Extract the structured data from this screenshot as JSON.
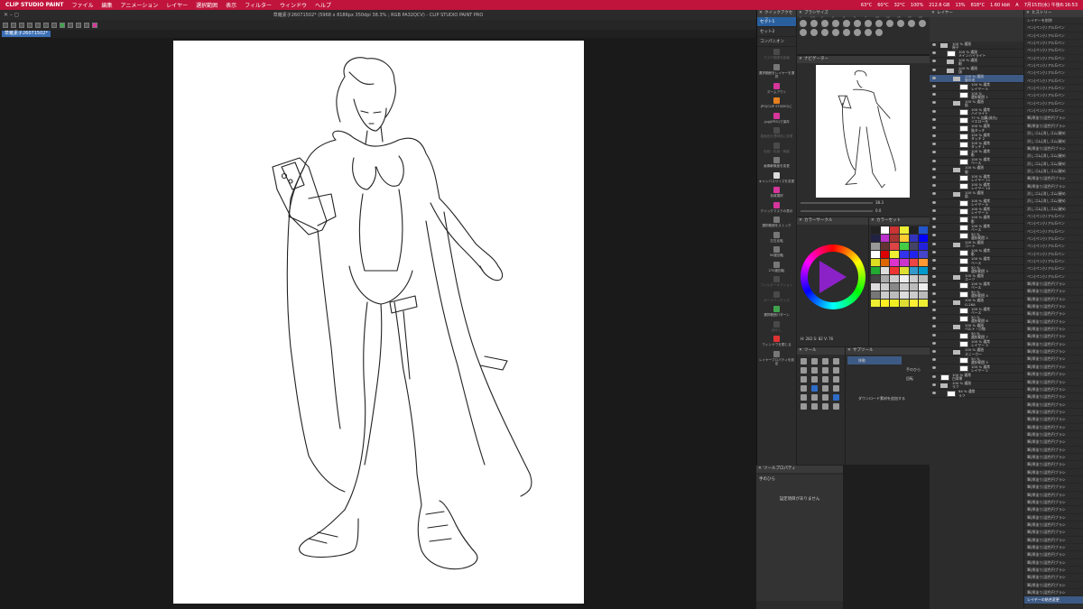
{
  "menubar": {
    "app": "CLIP STUDIO PAINT",
    "items": [
      "ファイル",
      "編集",
      "アニメーション",
      "レイヤー",
      "選択範囲",
      "表示",
      "フィルター",
      "ウィンドウ",
      "ヘルプ"
    ],
    "status": [
      "63°C",
      "60°C",
      "32°C",
      "100%",
      "212.6 GB",
      "13%",
      "818°C",
      "1.60 kbit",
      "A",
      "7月15日(水) 午後6:16:53"
    ]
  },
  "window": {
    "title": "草薙素子26071502* (5968 x 8186px 350dpi 38.3% ; RGB PA32QCV) - CLIP STUDIO PAINT PRO",
    "tab": "草薙素子26071502*"
  },
  "quickaccess": {
    "title": "クイックアクセス",
    "sets": [
      "セット1",
      "セット2",
      "コンパニオン"
    ],
    "items": [
      {
        "label": "マスク範囲を拡縮",
        "icon": "mask-icon",
        "dim": true
      },
      {
        "label": "選択範囲をレイヤーを選択",
        "icon": "selection-icon",
        "dim": false
      },
      {
        "label": "ズームアウト",
        "icon": "zoom-out-icon",
        "dim": false,
        "color": "mag"
      },
      {
        "label": "JPG(CLIP STUDIO)に",
        "icon": "export-icon",
        "dim": false,
        "color": "org"
      },
      {
        "label": ".jpg(JPEG)で保存",
        "icon": "save-jpg-icon",
        "dim": false,
        "color": "mag"
      },
      {
        "label": "描画色を透明色に変更",
        "icon": "transparent-icon",
        "dim": true
      },
      {
        "label": "色相・彩度・明度",
        "icon": "hue-icon",
        "dim": true
      },
      {
        "label": "画像解像度を変更",
        "icon": "resolution-icon",
        "dim": false
      },
      {
        "label": "キャンバスサイズを変更",
        "icon": "canvas-size-icon",
        "dim": false,
        "color": "wht"
      },
      {
        "label": "色域選択",
        "icon": "color-range-icon",
        "dim": false,
        "color": "mag"
      },
      {
        "label": "クイックマスクの表示",
        "icon": "quick-mask-icon",
        "dim": false,
        "color": "mag"
      },
      {
        "label": "選択範囲をストック",
        "icon": "stock-icon",
        "dim": false
      },
      {
        "label": "左右反転",
        "icon": "flip-icon",
        "dim": false
      },
      {
        "label": "90度回転",
        "icon": "rotate-icon",
        "dim": false
      },
      {
        "label": "270度回転",
        "icon": "rotate-270-icon",
        "dim": false
      },
      {
        "label": "フィルターオプション",
        "icon": "filter-icon",
        "dim": true,
        "color": "blu"
      },
      {
        "label": "ガードバッグイズ",
        "icon": "guard-icon",
        "dim": true
      },
      {
        "label": "選択範囲パターン",
        "icon": "pattern-icon",
        "dim": false,
        "color": "grn"
      },
      {
        "label": "ぼかし",
        "icon": "blur-icon",
        "dim": true
      },
      {
        "label": "ウィンドウを閉じる",
        "icon": "close-window-icon",
        "dim": false,
        "color": "red"
      },
      {
        "label": "レイヤープロパティを設定",
        "icon": "layer-prop-icon",
        "dim": false
      }
    ]
  },
  "brushsize": {
    "title": "ブラシサイズ",
    "sizes": [
      "1",
      "1.5",
      "2",
      "3",
      "4",
      "5",
      "7",
      "10",
      "12",
      "15",
      "17",
      "20",
      "25",
      "30",
      "40",
      "50",
      "60",
      "70",
      "80",
      "100"
    ]
  },
  "navigator": {
    "title": "ナビゲーター",
    "zoom": "38.3",
    "rotate": "0.0"
  },
  "colorcircle": {
    "title": "カラーサークル",
    "hsv": {
      "h": "H: 282",
      "s": "S: 82",
      "v": "V: 76"
    }
  },
  "colorset": {
    "title": "カラーセット",
    "swatches": [
      "#222",
      "#fff",
      "#c33",
      "#ee3",
      "#222",
      "#25c",
      "#224",
      "#b3c",
      "#a33",
      "#fc3",
      "#33b",
      "#00f",
      "#999",
      "#633",
      "#d44",
      "#4c4",
      "#446",
      "#22d",
      "#fff",
      "#d00",
      "#ee3",
      "#33e",
      "#22e",
      "#44c",
      "#dd2",
      "#d60",
      "#d3c",
      "#c3c",
      "#e44",
      "#f93",
      "#2a3",
      "#ddd",
      "#e33",
      "#dd3",
      "#39c",
      "#09c",
      "#444",
      "#aaa",
      "#ccc",
      "#eee",
      "#ccc",
      "#bbb",
      "#ddd",
      "#ccc",
      "#888",
      "#ccc",
      "#bbb",
      "#eee",
      "#777",
      "#ccc",
      "#bbb",
      "#ddd",
      "#ccc",
      "#bbb",
      "#ee3",
      "#fe2",
      "#ee2",
      "#dd3",
      "#fe3",
      "#ee3"
    ]
  },
  "tool": {
    "title": "ツール"
  },
  "subtool": {
    "title": "サブツール",
    "items": [
      "移動",
      "手のひら",
      "回転"
    ],
    "add": "ダウンロード素材を追加する"
  },
  "toolprop": {
    "title": "ツールプロパティ",
    "header": "手のひら",
    "empty": "設定項目がありません"
  },
  "layer": {
    "title": "レイヤー",
    "rows": [
      {
        "indent": 0,
        "kind": "folder",
        "l1": "100 % 通過",
        "l2": "原子"
      },
      {
        "indent": 1,
        "kind": "thumb",
        "l1": "100 % 通過",
        "l2": "メインハイライト"
      },
      {
        "indent": 1,
        "kind": "folder",
        "l1": "100 % 通過",
        "l2": "眼"
      },
      {
        "indent": 1,
        "kind": "folder",
        "l1": "100 % 通過",
        "l2": "顔"
      },
      {
        "indent": 2,
        "kind": "folder",
        "l1": "100 % 通過",
        "l2": "髪の毛",
        "sel": true
      },
      {
        "indent": 3,
        "kind": "thumb",
        "l1": "100 % 通常",
        "l2": "レイヤー 5"
      },
      {
        "indent": 3,
        "kind": "thumb",
        "l1": "100 %",
        "l2": "選択範囲 1"
      },
      {
        "indent": 2,
        "kind": "folder",
        "l1": "100 % 通過",
        "l2": "肌"
      },
      {
        "indent": 3,
        "kind": "thumb",
        "l1": "100 % 通常",
        "l2": "ハイライト"
      },
      {
        "indent": 3,
        "kind": "thumb",
        "l1": "77 % 加算(発光)",
        "l2": "イエロー光"
      },
      {
        "indent": 3,
        "kind": "thumb",
        "l1": "100 % 通常",
        "l2": "陰タッチ"
      },
      {
        "indent": 3,
        "kind": "thumb",
        "l1": "100 % 通常",
        "l2": "タッチ 2"
      },
      {
        "indent": 3,
        "kind": "thumb",
        "l1": "100 % 通常",
        "l2": "タッチ 1"
      },
      {
        "indent": 3,
        "kind": "thumb",
        "l1": "100 % 通常",
        "l2": "影"
      },
      {
        "indent": 3,
        "kind": "thumb",
        "l1": "100 % 通常",
        "l2": "ベース"
      },
      {
        "indent": 2,
        "kind": "folder",
        "l1": "100 % 通過",
        "l2": "服"
      },
      {
        "indent": 3,
        "kind": "thumb",
        "l1": "100 % 通常",
        "l2": "レイヤー 11"
      },
      {
        "indent": 3,
        "kind": "thumb",
        "l1": "100 % 通常",
        "l2": "レイヤー 10"
      },
      {
        "indent": 2,
        "kind": "folder",
        "l1": "100 % 通過",
        "l2": "肌"
      },
      {
        "indent": 3,
        "kind": "thumb",
        "l1": "100 % 通常",
        "l2": "レイヤー 8"
      },
      {
        "indent": 3,
        "kind": "thumb",
        "l1": "100 % 通常",
        "l2": "レイヤー 4"
      },
      {
        "indent": 3,
        "kind": "thumb",
        "l1": "100 % 通常",
        "l2": "影"
      },
      {
        "indent": 3,
        "kind": "thumb",
        "l1": "100 % 通常",
        "l2": "ベース"
      },
      {
        "indent": 3,
        "kind": "thumb",
        "l1": "50 %",
        "l2": "選択範囲 2"
      },
      {
        "indent": 2,
        "kind": "folder",
        "l1": "100 % 通過",
        "l2": "コート"
      },
      {
        "indent": 3,
        "kind": "thumb",
        "l1": "100 % 通常",
        "l2": "影"
      },
      {
        "indent": 3,
        "kind": "thumb",
        "l1": "100 % 通常",
        "l2": "ベース"
      },
      {
        "indent": 3,
        "kind": "thumb",
        "l1": "50 %",
        "l2": "選択範囲 3"
      },
      {
        "indent": 2,
        "kind": "folder",
        "l1": "100 % 通過",
        "l2": "スーツ"
      },
      {
        "indent": 3,
        "kind": "thumb",
        "l1": "100 % 通常",
        "l2": "ベース"
      },
      {
        "indent": 3,
        "kind": "thumb",
        "l1": "50 %",
        "l2": "選択範囲 4"
      },
      {
        "indent": 2,
        "kind": "folder",
        "l1": "100 % 通過",
        "l2": "G-26A"
      },
      {
        "indent": 3,
        "kind": "thumb",
        "l1": "100 % 通常",
        "l2": "ベース"
      },
      {
        "indent": 3,
        "kind": "thumb",
        "l1": "50 %",
        "l2": "選択範囲 6"
      },
      {
        "indent": 2,
        "kind": "folder",
        "l1": "100 % 通過",
        "l2": "ベルト・小物"
      },
      {
        "indent": 3,
        "kind": "thumb",
        "l1": "50 %",
        "l2": "選択範囲 7"
      },
      {
        "indent": 3,
        "kind": "thumb",
        "l1": "100 % 通常",
        "l2": "レイヤー 3"
      },
      {
        "indent": 2,
        "kind": "folder",
        "l1": "100 % 通過",
        "l2": "スニーカー"
      },
      {
        "indent": 3,
        "kind": "thumb",
        "l1": "50 %",
        "l2": "選択範囲 5"
      },
      {
        "indent": 3,
        "kind": "thumb",
        "l1": "100 % 通常",
        "l2": "レイヤー 2"
      },
      {
        "indent": 0,
        "kind": "thumb",
        "l1": "100 % 通常",
        "l2": "白背景"
      },
      {
        "indent": 0,
        "kind": "folder",
        "l1": "100 % 通過",
        "l2": "ラフ"
      },
      {
        "indent": 1,
        "kind": "thumb",
        "l1": "84 % 通常",
        "l2": "ラフ"
      }
    ]
  },
  "history": {
    "title": "ヒストリー",
    "items": [
      "レイヤーを削除",
      "ペン|ペン|リアルGペン",
      "ペン|ペン|リアルGペン",
      "ペン|ペン|リアルGペン",
      "ペン|ペン|リアルGペン",
      "ペン|ペン|リアルGペン",
      "ペン|ペン|リアルGペン",
      "ペン|ペン|リアルGペン",
      "ペン|ペン|リアルGペン",
      "ペン|ペン|リアルGペン",
      "ペン|ペン|リアルGペン",
      "ペン|ペン|リアルGペン",
      "ペン|ペン|リアルGペン",
      "筆|厚塗り|混色円ブラシ",
      "筆|厚塗り|混色円ブラシ",
      "消しゴム|消しゴム|硬め",
      "消しゴム|消しゴム|硬め",
      "筆|厚塗り|混色円ブラシ",
      "消しゴム|消しゴム|硬め",
      "消しゴム|消しゴム|硬め",
      "消しゴム|消しゴム|硬め",
      "筆|厚塗り|混色円ブラシ",
      "筆|厚塗り|混色円ブラシ",
      "消しゴム|消しゴム|硬め",
      "消しゴム|消しゴム|硬め",
      "消しゴム|消しゴム|硬め",
      "ペン|ペン|リアルGペン",
      "ペン|ペン|リアルGペン",
      "ペン|ペン|リアルGペン",
      "ペン|ペン|リアルGペン",
      "ペン|ペン|リアルGペン",
      "ペン|ペン|リアルGペン",
      "ペン|ペン|リアルGペン",
      "ペン|ペン|リアルGペン",
      "ペン|ペン|リアルGペン",
      "筆|厚塗り|混色円ブラシ",
      "筆|厚塗り|混色円ブラシ",
      "筆|厚塗り|混色円ブラシ",
      "筆|厚塗り|混色円ブラシ",
      "筆|厚塗り|混色円ブラシ",
      "筆|厚塗り|混色円ブラシ",
      "筆|厚塗り|混色円ブラシ",
      "筆|厚塗り|混色円ブラシ",
      "筆|厚塗り|混色円ブラシ",
      "筆|厚塗り|混色円ブラシ",
      "筆|厚塗り|混色円ブラシ",
      "筆|厚塗り|混色円ブラシ",
      "筆|厚塗り|混色円ブラシ",
      "筆|厚塗り|混色円ブラシ",
      "筆|厚塗り|混色円ブラシ",
      "筆|厚塗り|混色円ブラシ",
      "筆|厚塗り|混色円ブラシ",
      "筆|厚塗り|混色円ブラシ",
      "筆|厚塗り|混色円ブラシ",
      "筆|厚塗り|混色円ブラシ",
      "筆|厚塗り|混色円ブラシ",
      "筆|厚塗り|混色円ブラシ",
      "筆|厚塗り|混色円ブラシ",
      "筆|厚塗り|混色円ブラシ",
      "筆|厚塗り|混色円ブラシ",
      "筆|厚塗り|混色円ブラシ",
      "筆|厚塗り|混色円ブラシ",
      "筆|厚塗り|混色円ブラシ",
      "筆|厚塗り|混色円ブラシ",
      "筆|厚塗り|混色円ブラシ",
      "筆|厚塗り|混色円ブラシ",
      "筆|厚塗り|混色円ブラシ",
      "筆|厚塗り|混色円ブラシ",
      "筆|厚塗り|混色円ブラシ",
      "筆|厚塗り|混色円ブラシ",
      "筆|厚塗り|混色円ブラシ",
      "筆|厚塗り|混色円ブラシ",
      "筆|厚塗り|混色円ブラシ",
      "筆|厚塗り|混色円ブラシ",
      "筆|厚塗り|混色円ブラシ",
      "筆|厚塗り|混色円ブラシ",
      "筆|厚塗り|混色円ブラシ",
      "レイヤーの結合変更"
    ]
  }
}
